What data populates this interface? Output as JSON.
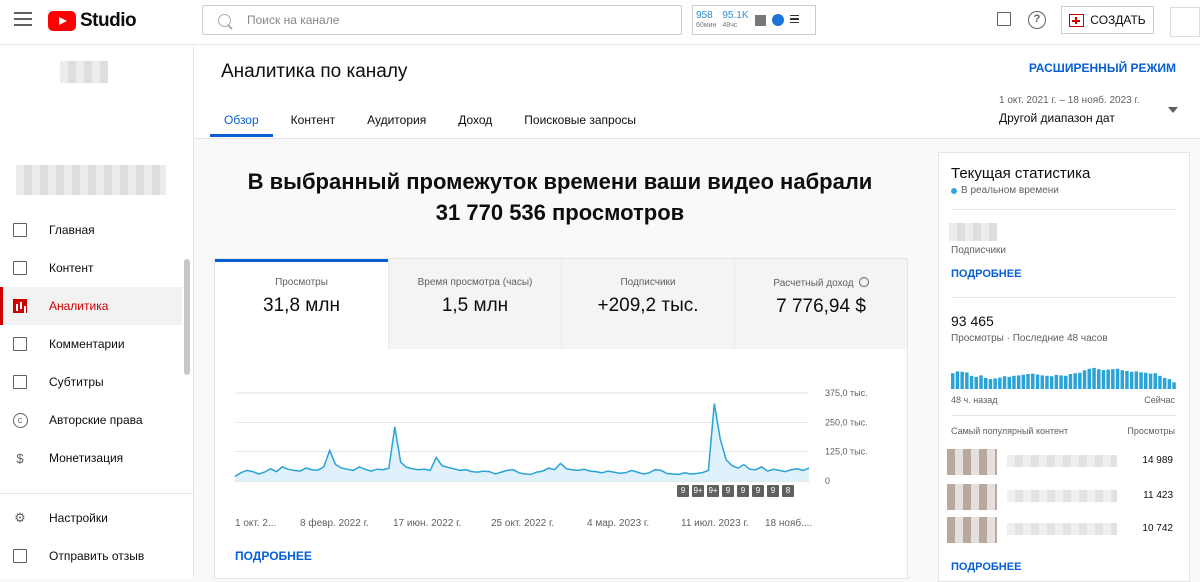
{
  "topbar": {
    "logo_text": "Studio",
    "search_placeholder": "Поиск на канале",
    "ext_stats": [
      {
        "num": "958",
        "label": "60мин"
      },
      {
        "num": "95.1K",
        "label": "48чс"
      }
    ],
    "create_label": "СОЗДАТЬ"
  },
  "sidebar": {
    "items": [
      {
        "label": "Главная",
        "icon": "dashboard-icon"
      },
      {
        "label": "Контент",
        "icon": "content-icon"
      },
      {
        "label": "Аналитика",
        "icon": "analytics-icon",
        "active": true
      },
      {
        "label": "Комментарии",
        "icon": "comments-icon"
      },
      {
        "label": "Субтитры",
        "icon": "subtitles-icon"
      },
      {
        "label": "Авторские права",
        "icon": "copyright-icon"
      },
      {
        "label": "Монетизация",
        "icon": "monetization-icon"
      }
    ],
    "bottom_items": [
      {
        "label": "Настройки",
        "icon": "gear-icon"
      },
      {
        "label": "Отправить отзыв",
        "icon": "feedback-icon"
      }
    ]
  },
  "header": {
    "title": "Аналитика по каналу",
    "advanced_label": "РАСШИРЕННЫЙ РЕЖИМ",
    "tabs": [
      "Обзор",
      "Контент",
      "Аудитория",
      "Доход",
      "Поисковые запросы"
    ],
    "date_range": "1 окт. 2021 г. – 18 нояб. 2023 г.",
    "date_label": "Другой диапазон дат"
  },
  "main": {
    "headline_line1": "В выбранный промежуток времени ваши видео набрали",
    "headline_line2": "31 770 536 просмотров",
    "metrics": [
      {
        "label": "Просмотры",
        "value": "31,8 млн"
      },
      {
        "label": "Время просмотра (часы)",
        "value": "1,5 млн"
      },
      {
        "label": "Подписчики",
        "value": "+209,2 тыс."
      },
      {
        "label": "Расчетный доход",
        "value": "7 776,94 $"
      }
    ],
    "badges": [
      "9",
      "9+",
      "9+",
      "9",
      "9",
      "9",
      "9",
      "8"
    ],
    "more_label": "ПОДРОБНЕЕ"
  },
  "chart_data": {
    "type": "line",
    "x_tick_labels": [
      "1 окт. 2...",
      "8 февр. 2022 г.",
      "17 июн. 2022 г.",
      "25 окт. 2022 г.",
      "4 мар. 2023 г.",
      "11 июл. 2023 г.",
      "18 нояб...."
    ],
    "y_tick_labels": [
      "375,0 тыс.",
      "250,0 тыс.",
      "125,0 тыс.",
      "0"
    ],
    "ylim": [
      0,
      375000
    ],
    "grid": true,
    "color": "#2aa3d6",
    "series": [
      {
        "values": [
          20000,
          35000,
          45000,
          40000,
          30000,
          38000,
          52000,
          40000,
          60000,
          50000,
          45000,
          42000,
          55000,
          48000,
          46000,
          60000,
          130000,
          70000,
          55000,
          50000,
          45000,
          60000,
          50000,
          42000,
          50000,
          48000,
          55000,
          230000,
          80000,
          58000,
          52000,
          48000,
          50000,
          45000,
          100000,
          65000,
          58000,
          52000,
          45000,
          48000,
          40000,
          38000,
          42000,
          40000,
          30000,
          38000,
          45000,
          48000,
          35000,
          30000,
          28000,
          38000,
          42000,
          55000,
          48000,
          75000,
          52000,
          48000,
          45000,
          50000,
          42000,
          40000,
          35000,
          42000,
          38000,
          33000,
          35000,
          45000,
          38000,
          30000,
          35000,
          48000,
          45000,
          32000,
          30000,
          28000,
          35000,
          30000,
          32000,
          36000,
          45000,
          330000,
          180000,
          90000,
          65000,
          55000,
          70000,
          50000,
          48000,
          60000,
          42000,
          50000,
          45000,
          40000,
          48000,
          52000,
          45000,
          55000
        ]
      }
    ]
  },
  "realtime": {
    "title": "Текущая статистика",
    "live_label": "В реальном времени",
    "subs_label": "Подписчики",
    "more_label": "ПОДРОБНЕЕ",
    "views_value": "93 465",
    "views_label": "Просмотры · Последние 48 часов",
    "axis_left": "48 ч. назад",
    "axis_right": "Сейчас",
    "popular_header": "Самый популярный контент",
    "popular_col": "Просмотры",
    "popular_values": [
      "14 989",
      "11 423",
      "10 742"
    ],
    "more2_label": "ПОДРОБНЕЕ",
    "bars_color": "#2aa3d6",
    "bars": [
      0.72,
      0.8,
      0.78,
      0.75,
      0.6,
      0.55,
      0.62,
      0.5,
      0.45,
      0.48,
      0.52,
      0.58,
      0.55,
      0.6,
      0.62,
      0.65,
      0.68,
      0.7,
      0.66,
      0.62,
      0.6,
      0.58,
      0.64,
      0.62,
      0.6,
      0.68,
      0.72,
      0.74,
      0.85,
      0.92,
      0.96,
      0.9,
      0.86,
      0.88,
      0.9,
      0.92,
      0.85,
      0.82,
      0.78,
      0.8,
      0.76,
      0.74,
      0.7,
      0.72,
      0.6,
      0.5,
      0.45,
      0.3
    ]
  }
}
